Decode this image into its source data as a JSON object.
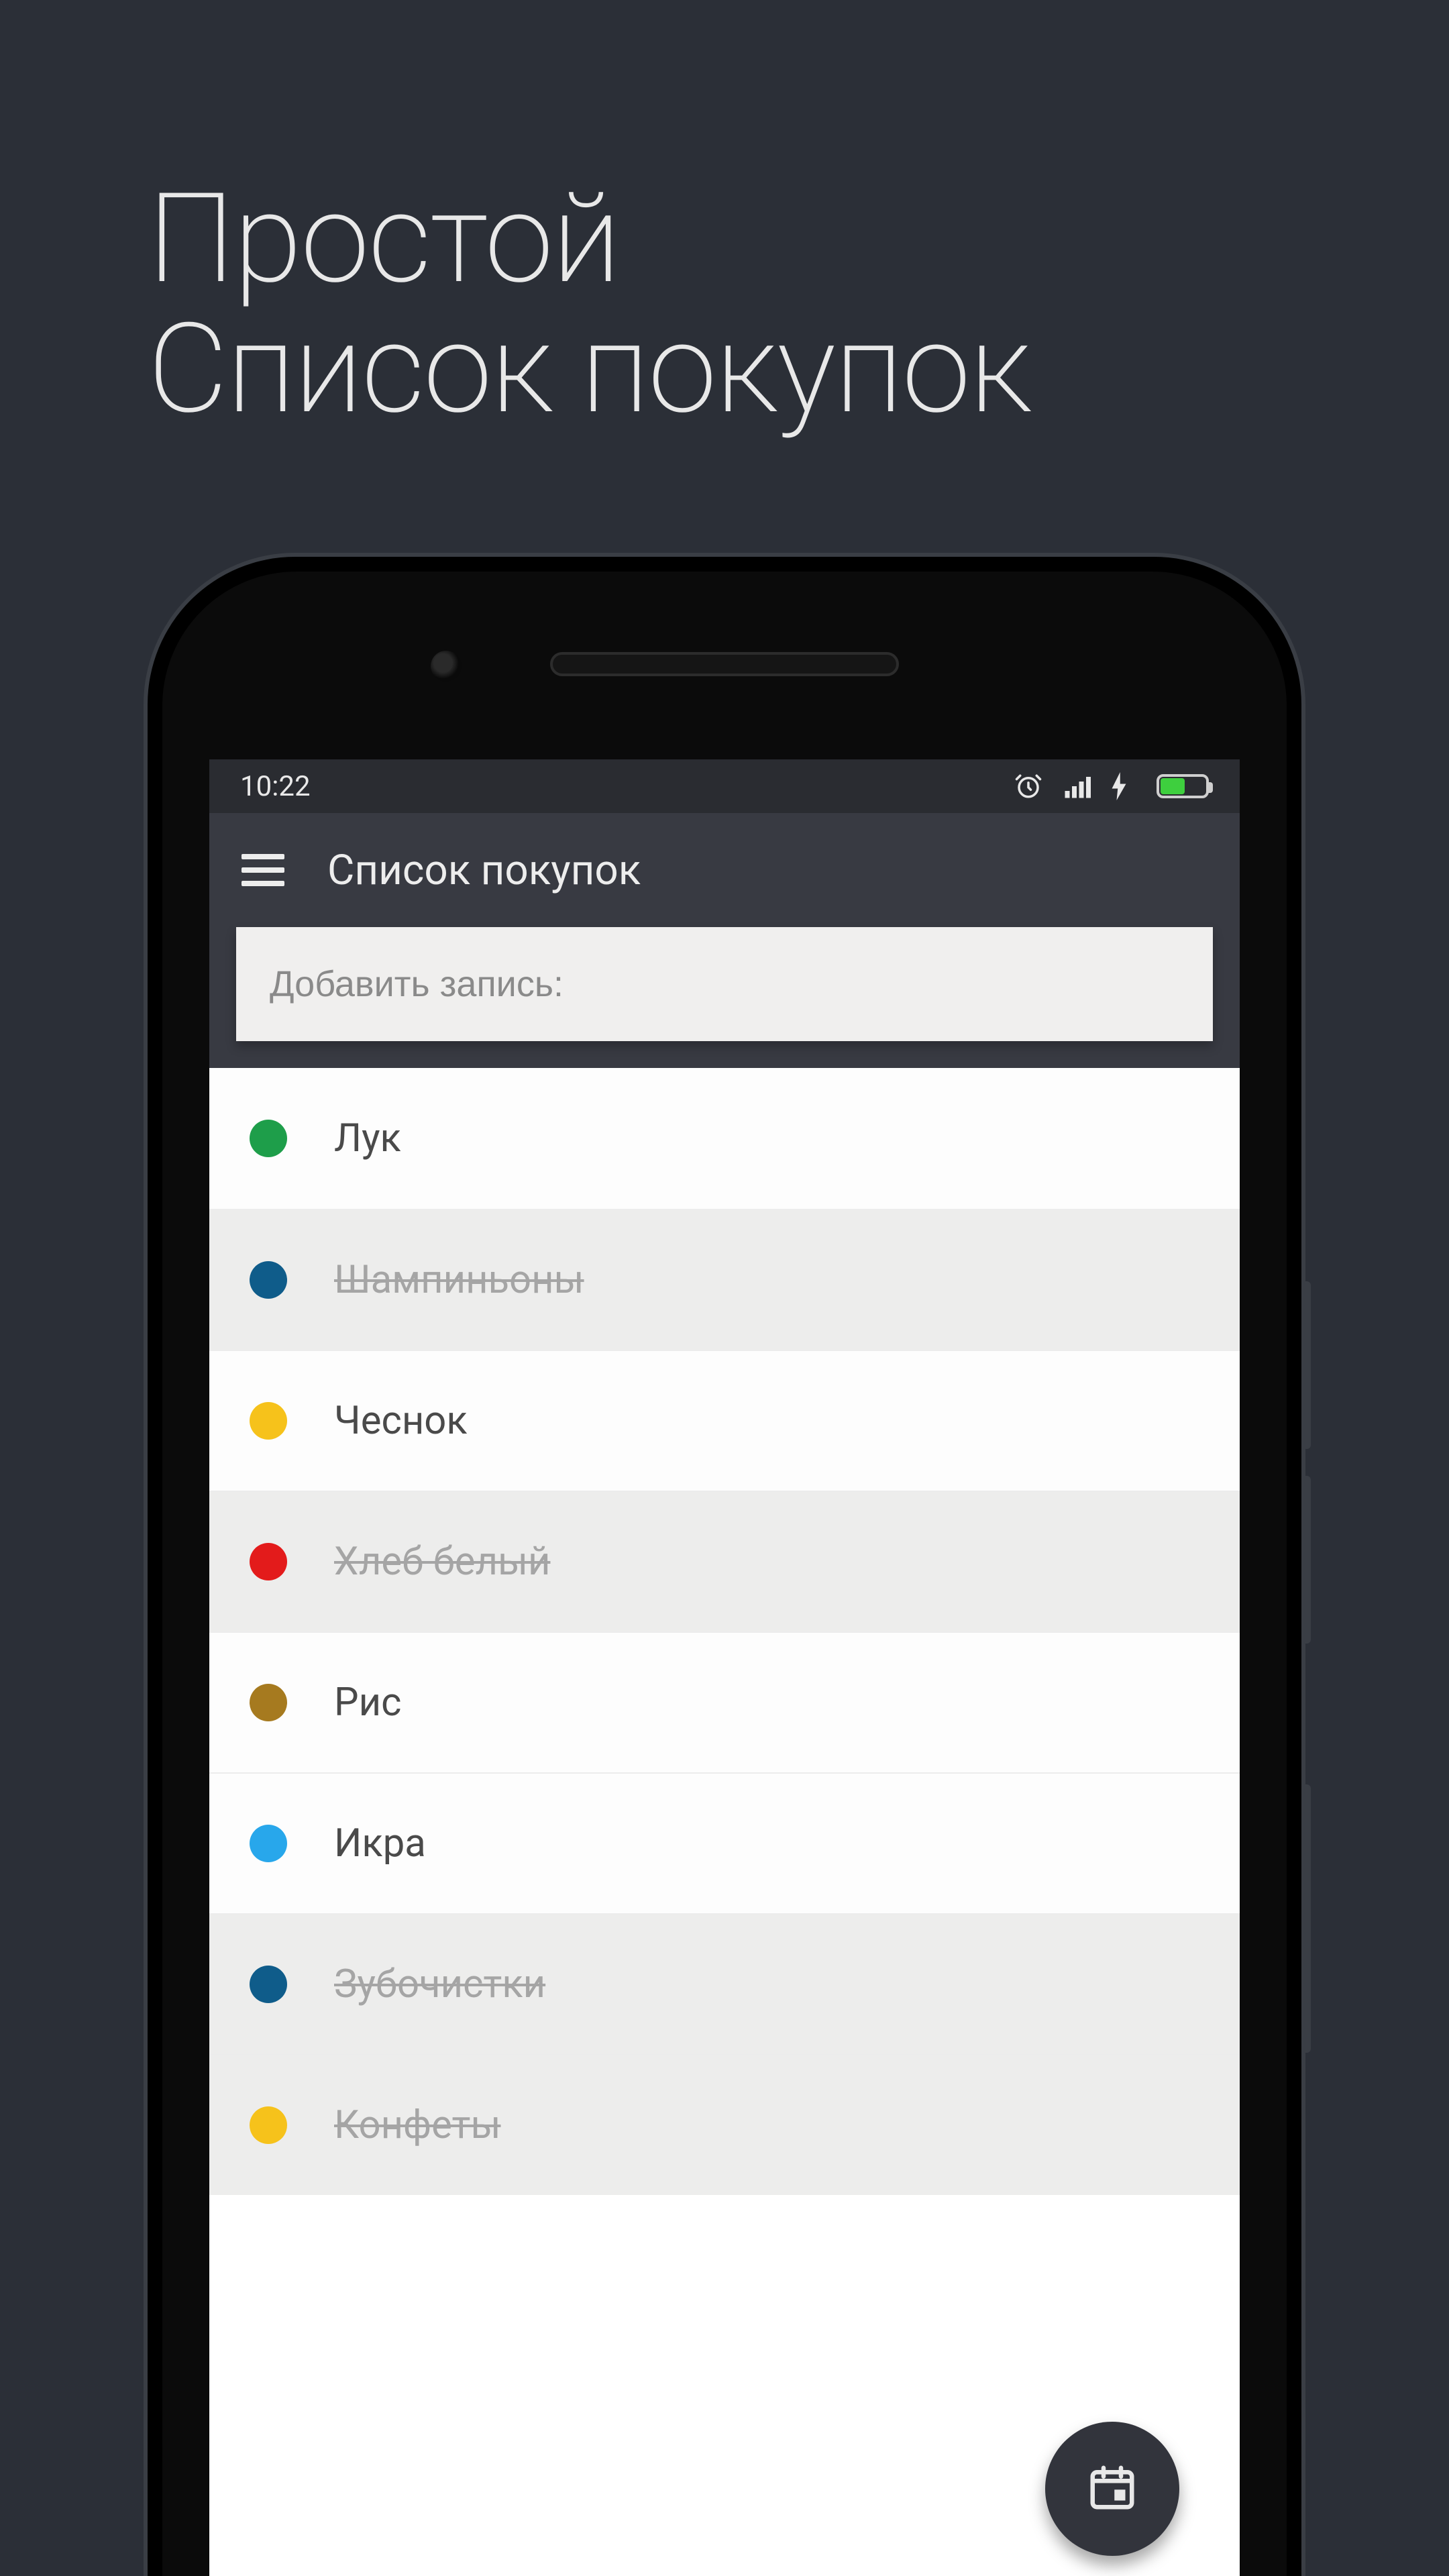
{
  "promo": {
    "line1": "Простой",
    "line2": "Список покупок"
  },
  "statusbar": {
    "time": "10:22",
    "icons": [
      "alarm",
      "signal",
      "charge",
      "battery"
    ]
  },
  "appbar": {
    "title": "Список покупок"
  },
  "add_field": {
    "placeholder": "Добавить запись:"
  },
  "colors": {
    "green": "#1e9e4a",
    "navy": "#0f5c8a",
    "yellow": "#f6c21b",
    "red": "#e31b1b",
    "brown": "#a67a1f",
    "sky": "#28a7eb"
  },
  "items": [
    {
      "label": "Лук",
      "color": "green",
      "done": false
    },
    {
      "label": "Шампиньоны",
      "color": "navy",
      "done": true
    },
    {
      "label": "Чеснок",
      "color": "yellow",
      "done": false
    },
    {
      "label": "Хлеб белый",
      "color": "red",
      "done": true
    },
    {
      "label": "Рис",
      "color": "brown",
      "done": false
    },
    {
      "label": "Икра",
      "color": "sky",
      "done": false
    },
    {
      "label": "Зубочистки",
      "color": "navy",
      "done": true
    },
    {
      "label": "Конфеты",
      "color": "yellow",
      "done": true
    }
  ]
}
